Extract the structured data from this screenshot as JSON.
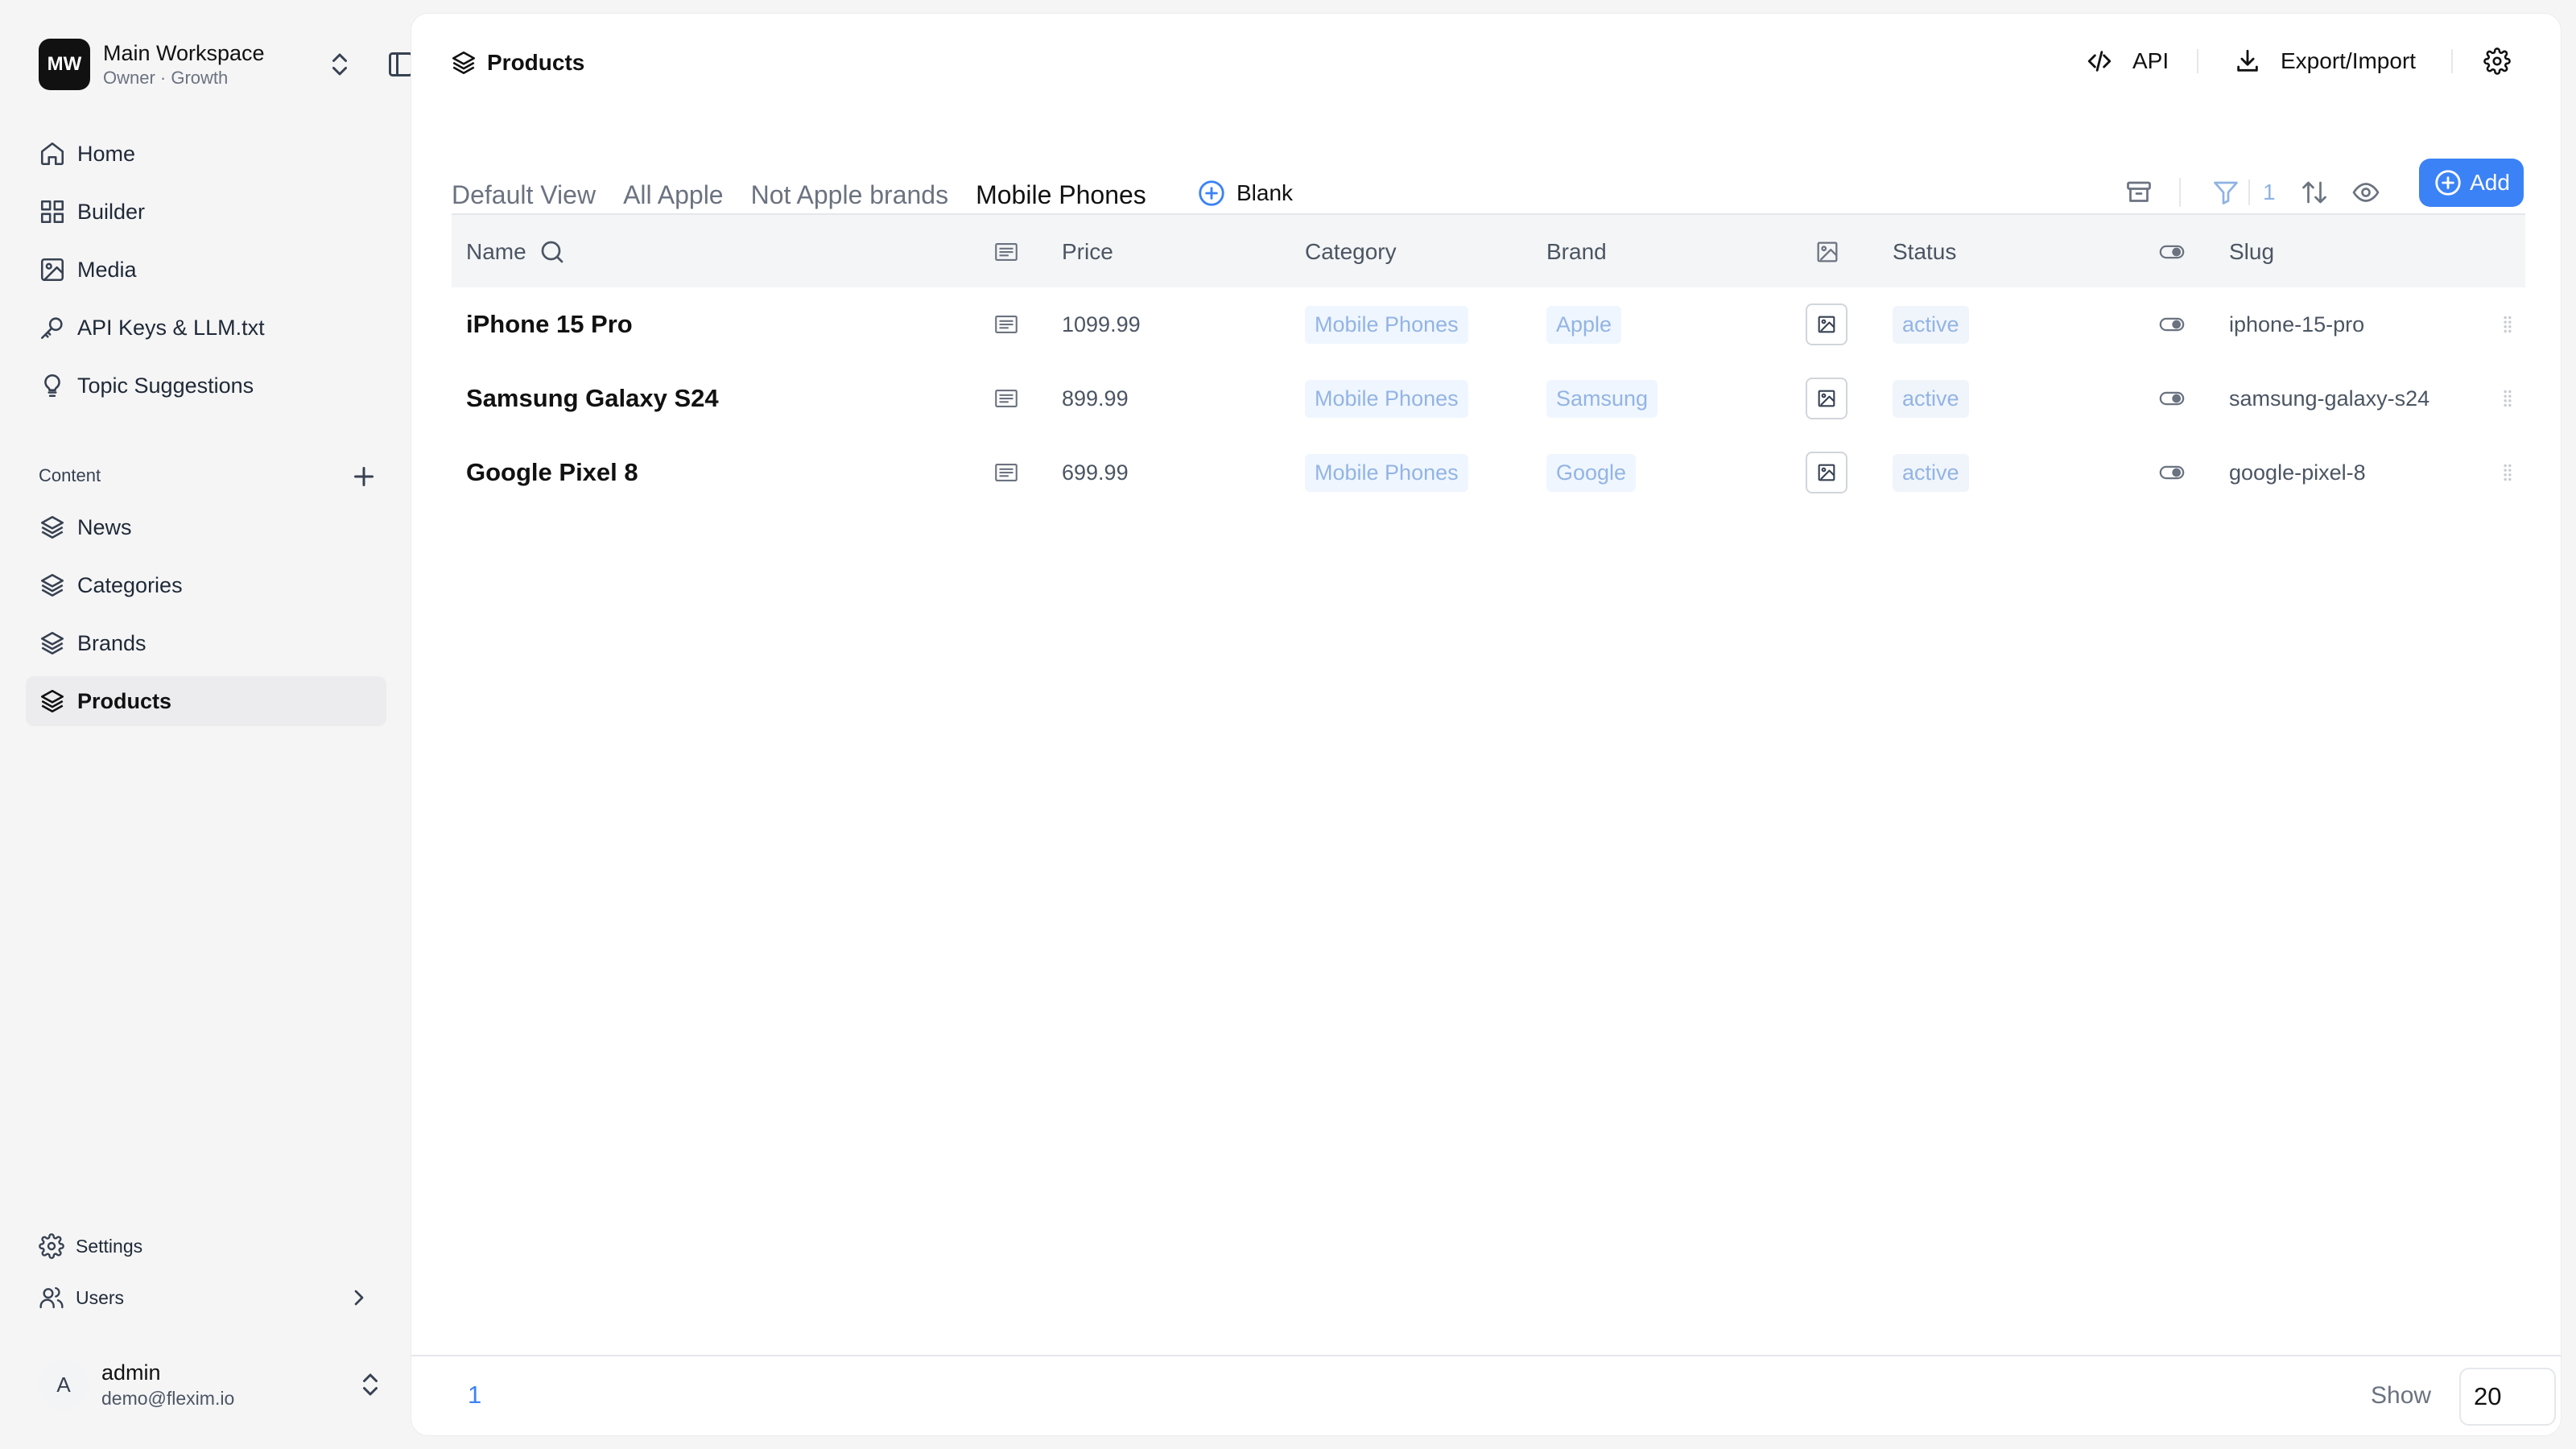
{
  "workspace": {
    "initials": "MW",
    "name": "Main Workspace",
    "role": "Owner · Growth"
  },
  "nav": [
    {
      "label": "Home",
      "icon": "home-icon"
    },
    {
      "label": "Builder",
      "icon": "grid-icon"
    },
    {
      "label": "Media",
      "icon": "image-icon"
    },
    {
      "label": "API Keys & LLM.txt",
      "icon": "key-icon"
    },
    {
      "label": "Topic Suggestions",
      "icon": "lightbulb-icon"
    }
  ],
  "content_section": {
    "label": "Content",
    "items": [
      {
        "label": "News",
        "icon": "layers-icon"
      },
      {
        "label": "Categories",
        "icon": "layers-icon"
      },
      {
        "label": "Brands",
        "icon": "layers-icon"
      },
      {
        "label": "Products",
        "icon": "layers-icon",
        "active": true
      }
    ]
  },
  "footer_nav": {
    "settings": "Settings",
    "users": "Users"
  },
  "user": {
    "initial": "A",
    "name": "admin",
    "email": "demo@flexim.io"
  },
  "header": {
    "title": "Products",
    "api": "API",
    "export_import": "Export/Import"
  },
  "tabs": [
    {
      "label": "Default View"
    },
    {
      "label": "All Apple"
    },
    {
      "label": "Not Apple brands"
    },
    {
      "label": "Mobile Phones",
      "active": true
    }
  ],
  "tab_add": "Blank",
  "toolbar": {
    "filter_count": "1",
    "add_label": "Add"
  },
  "table": {
    "columns": {
      "name": "Name",
      "price": "Price",
      "category": "Category",
      "brand": "Brand",
      "status": "Status",
      "slug": "Slug"
    },
    "rows": [
      {
        "name": "iPhone 15 Pro",
        "price": "1099.99",
        "category": "Mobile Phones",
        "brand": "Apple",
        "status": "active",
        "slug": "iphone-15-pro"
      },
      {
        "name": "Samsung Galaxy S24",
        "price": "899.99",
        "category": "Mobile Phones",
        "brand": "Samsung",
        "status": "active",
        "slug": "samsung-galaxy-s24"
      },
      {
        "name": "Google Pixel 8",
        "price": "699.99",
        "category": "Mobile Phones",
        "brand": "Google",
        "status": "active",
        "slug": "google-pixel-8"
      }
    ]
  },
  "pagination": {
    "page": "1",
    "show_label": "Show",
    "page_size": "20"
  },
  "colors": {
    "accent": "#3b82f6",
    "tag_bg": "#eff6ff",
    "tag_text": "#93b4e4"
  }
}
